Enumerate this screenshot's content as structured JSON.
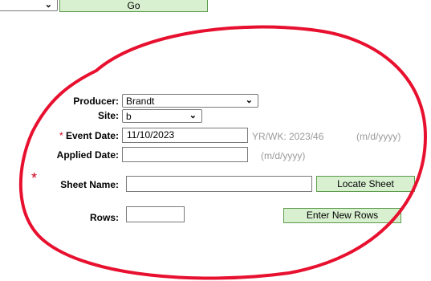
{
  "top": {
    "go_label": "Go"
  },
  "form": {
    "producer_label": "Producer:",
    "producer_value": "Brandt",
    "site_label": "Site:",
    "site_value": "b",
    "event_date_req": "*",
    "event_date_label": "Event Date:",
    "event_date_value": "11/10/2023",
    "event_week": "YR/WK: 2023/46",
    "event_date_format": "(m/d/yyyy)",
    "applied_date_label": "Applied Date:",
    "applied_date_value": "",
    "applied_date_format": "(m/d/yyyy)",
    "sheet_name_req": "*",
    "sheet_name_label": "Sheet Name:",
    "sheet_name_value": "",
    "locate_sheet_label": "Locate Sheet",
    "rows_label": "Rows:",
    "rows_value": "",
    "enter_rows_label": "Enter New Rows"
  },
  "annotation": {
    "color": "#e8102f"
  }
}
